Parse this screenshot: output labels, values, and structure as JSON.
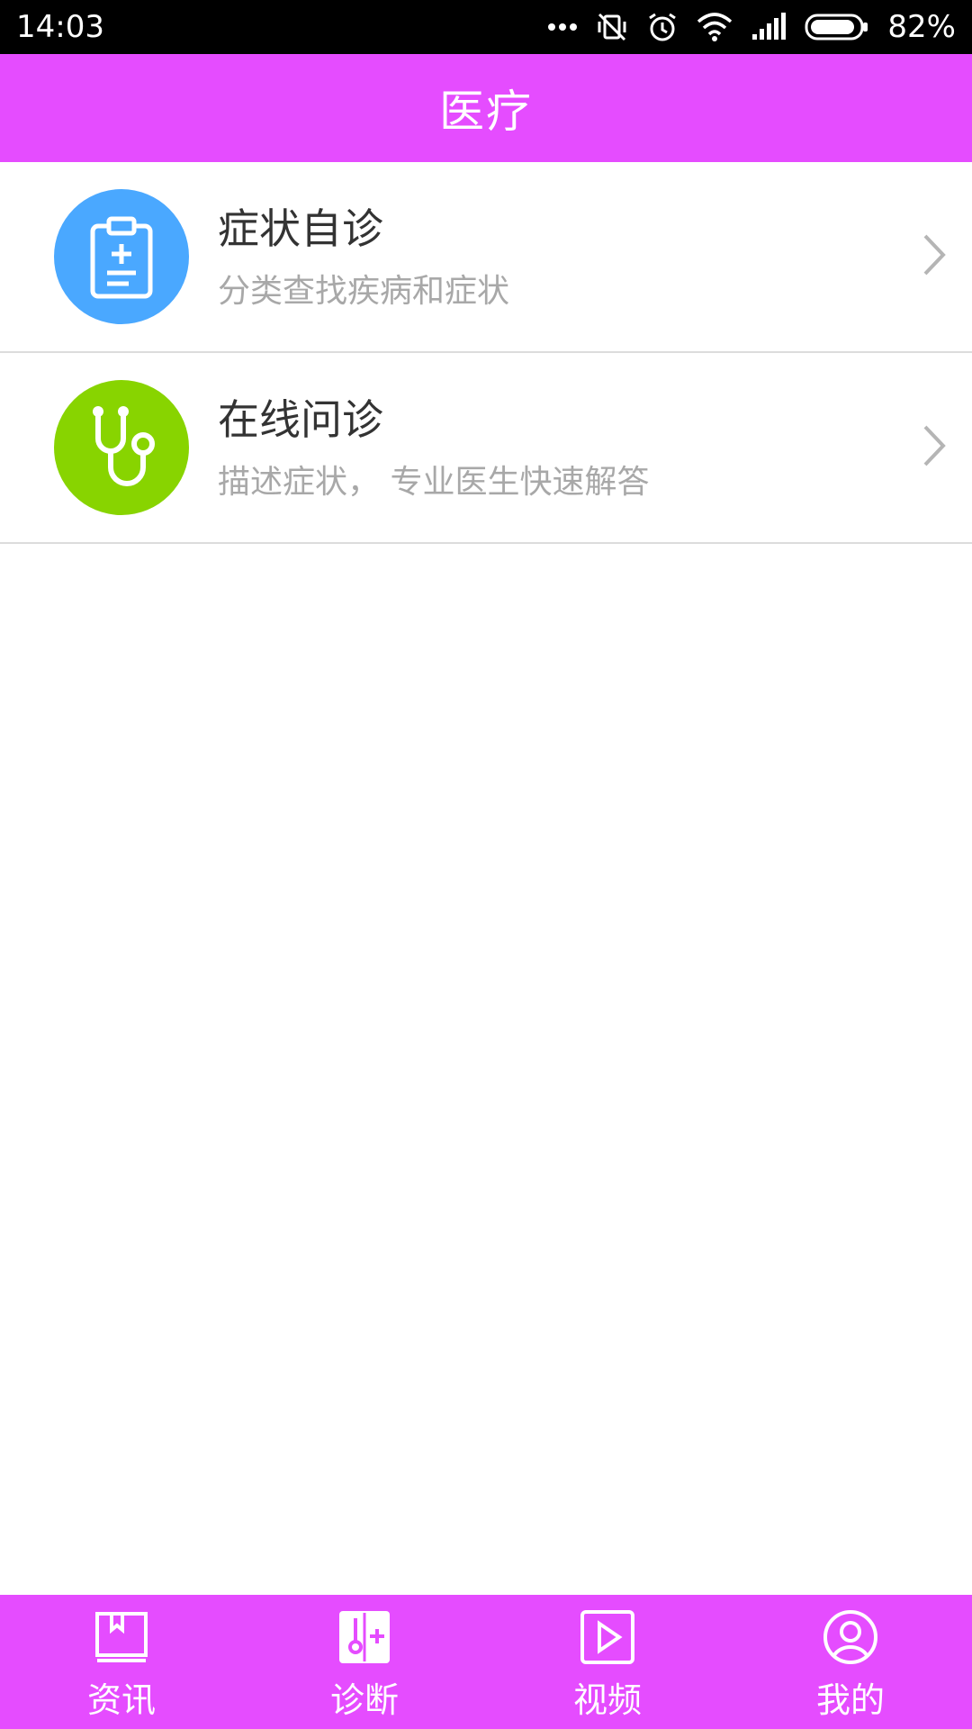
{
  "status_bar": {
    "time": "14:03",
    "battery": "82%",
    "icons": [
      "more-dots-icon",
      "vibrate-off-icon",
      "alarm-icon",
      "wifi-icon",
      "signal-icon",
      "battery-icon"
    ]
  },
  "header": {
    "title": "医疗"
  },
  "list": [
    {
      "title": "症状自诊",
      "subtitle": "分类查找疾病和症状",
      "icon": "clipboard-plus-icon",
      "color": "#4aa8ff"
    },
    {
      "title": "在线问诊",
      "subtitle": "描述症状， 专业医生快速解答",
      "icon": "stethoscope-icon",
      "color": "#88d400"
    }
  ],
  "tabs": [
    {
      "label": "资讯",
      "icon": "book-icon"
    },
    {
      "label": "诊断",
      "icon": "diagnosis-icon",
      "selected": true
    },
    {
      "label": "视频",
      "icon": "play-icon"
    },
    {
      "label": "我的",
      "icon": "user-icon"
    }
  ],
  "colors": {
    "accent": "#e54cff",
    "blue": "#4aa8ff",
    "green": "#88d400"
  }
}
